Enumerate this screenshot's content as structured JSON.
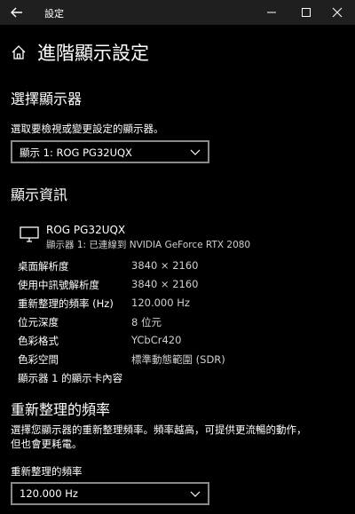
{
  "window": {
    "title": "設定",
    "back_icon": "back-arrow-icon",
    "min_icon": "minimize-icon",
    "max_icon": "maximize-icon",
    "close_icon": "close-icon"
  },
  "page": {
    "title": "進階顯示設定",
    "icon": "home-icon"
  },
  "choose_display": {
    "heading": "選擇顯示器",
    "prompt": "選取要檢視或變更設定的顯示器。",
    "selected": "顯示 1: ROG PG32UQX"
  },
  "display_info": {
    "heading": "顯示資訊",
    "monitor_name": "ROG PG32UQX",
    "connection": "顯示器 1: 已連線到 NVIDIA GeForce RTX 2080",
    "rows": [
      {
        "label": "桌面解析度",
        "value": "3840 × 2160"
      },
      {
        "label": "使用中訊號解析度",
        "value": "3840 × 2160"
      },
      {
        "label": "重新整理的頻率 (Hz)",
        "value": "120.000 Hz"
      },
      {
        "label": "位元深度",
        "value": "8 位元"
      },
      {
        "label": "色彩格式",
        "value": "YCbCr420"
      },
      {
        "label": "色彩空間",
        "value": "標準動態範圍 (SDR)"
      }
    ],
    "adapter_link": "顯示器 1 的顯示卡內容"
  },
  "refresh": {
    "heading": "重新整理的頻率",
    "description_line1": "選擇您顯示器的重新整理頻率。頻率越高，可提供更流暢的動作，",
    "description_line2": "但也會更耗電。",
    "field_label": "重新整理的頻率",
    "selected": "120.000 Hz"
  },
  "colors": {
    "background": "#000000",
    "titlebar": "#1f1f1f",
    "text": "#ffffff",
    "border": "#8a8a8a"
  }
}
